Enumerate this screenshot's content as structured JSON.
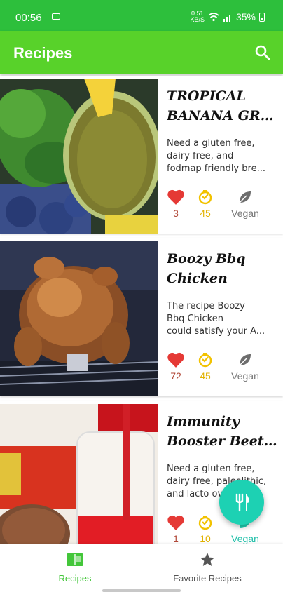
{
  "status_bar": {
    "time": "00:56",
    "network": "0.51\nKB/S",
    "battery": "35%"
  },
  "app_bar": {
    "title": "Recipes",
    "search_icon": "search-icon"
  },
  "recipes": [
    {
      "title_lines": [
        "TROPICAL",
        "BANANA GRE..."
      ],
      "desc_lines": [
        "Need a gluten free,",
        "dairy free, and",
        "fodmap friendly bre..."
      ],
      "likes": "3",
      "minutes": "45",
      "diet": "Vegan"
    },
    {
      "title_lines": [
        "Boozy Bbq",
        "Chicken"
      ],
      "desc_lines": [
        "The recipe Boozy",
        "Bbq Chicken",
        "could satisfy your A..."
      ],
      "likes": "72",
      "minutes": "45",
      "diet": "Vegan"
    },
    {
      "title_lines": [
        "Immunity",
        "Booster Beet, ..."
      ],
      "desc_lines": [
        "Need a gluten free,",
        "dairy free, paleolithic,",
        "and lacto ov..."
      ],
      "likes": "1",
      "minutes": "10",
      "diet": "Vegan"
    }
  ],
  "bottom_nav": {
    "recipes": "Recipes",
    "favorites": "Favorite Recipes"
  },
  "colors": {
    "status_bar": "#2dbf3c",
    "app_bar": "#58d22a",
    "heart": "#e53935",
    "clock": "#f2c200",
    "leaf": "#6d6d6d",
    "fab": "#1dd1b3",
    "active_nav": "#43c63a"
  }
}
